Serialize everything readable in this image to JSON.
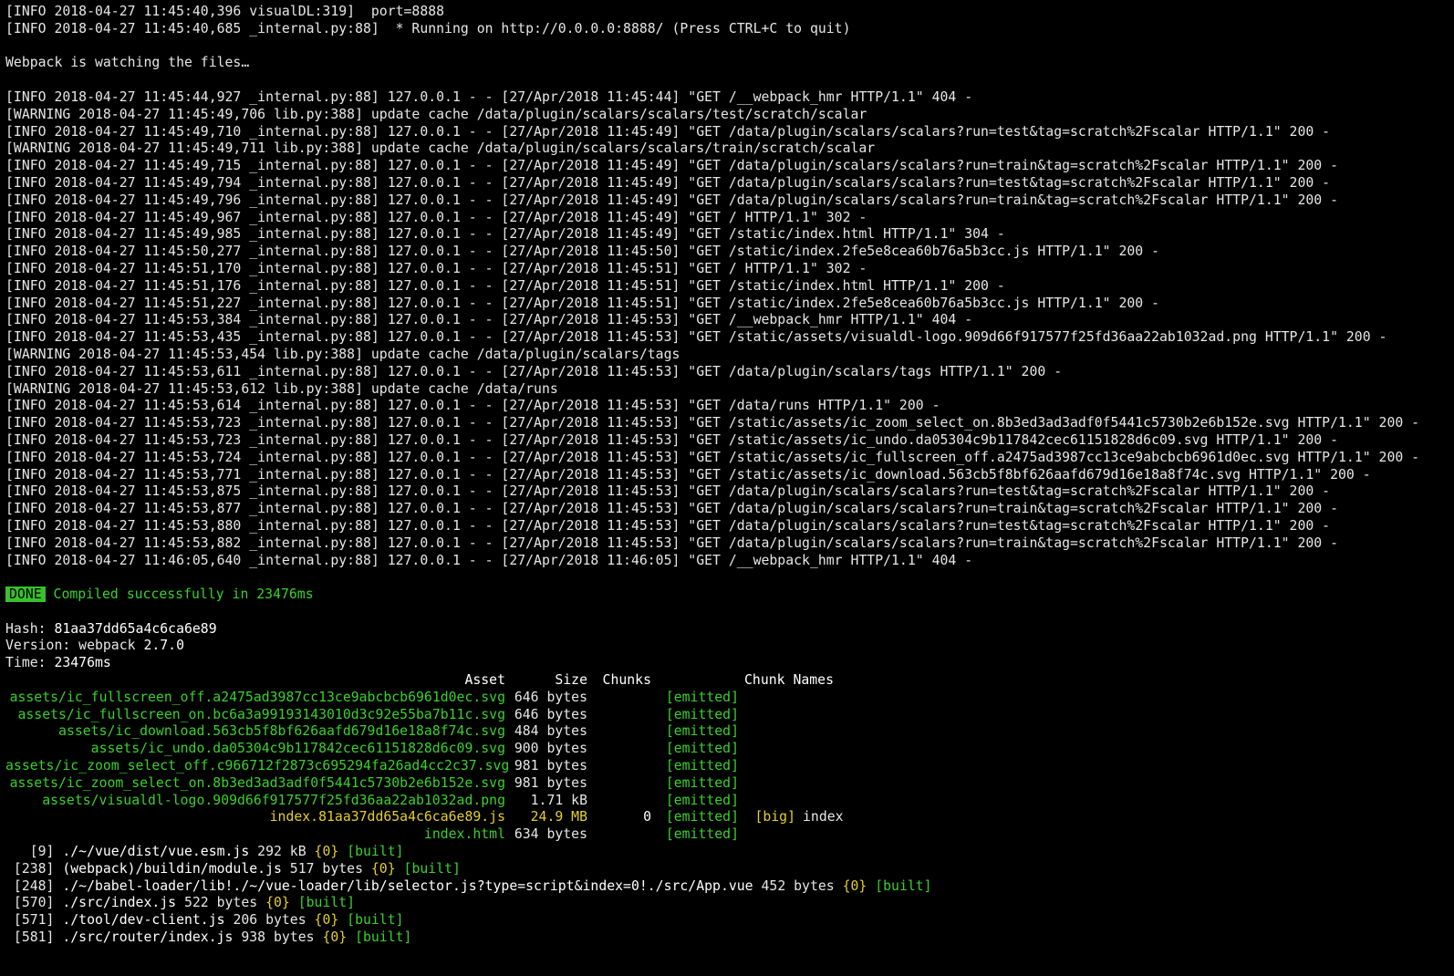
{
  "log_lines": [
    "[INFO 2018-04-27 11:45:40,396 visualDL:319]  port=8888",
    "[INFO 2018-04-27 11:45:40,685 _internal.py:88]  * Running on http://0.0.0.0:8888/ (Press CTRL+C to quit)",
    "",
    "Webpack is watching the files…",
    "",
    "[INFO 2018-04-27 11:45:44,927 _internal.py:88] 127.0.0.1 - - [27/Apr/2018 11:45:44] \"GET /__webpack_hmr HTTP/1.1\" 404 -",
    "[WARNING 2018-04-27 11:45:49,706 lib.py:388] update cache /data/plugin/scalars/scalars/test/scratch/scalar",
    "[INFO 2018-04-27 11:45:49,710 _internal.py:88] 127.0.0.1 - - [27/Apr/2018 11:45:49] \"GET /data/plugin/scalars/scalars?run=test&tag=scratch%2Fscalar HTTP/1.1\" 200 -",
    "[WARNING 2018-04-27 11:45:49,711 lib.py:388] update cache /data/plugin/scalars/scalars/train/scratch/scalar",
    "[INFO 2018-04-27 11:45:49,715 _internal.py:88] 127.0.0.1 - - [27/Apr/2018 11:45:49] \"GET /data/plugin/scalars/scalars?run=train&tag=scratch%2Fscalar HTTP/1.1\" 200 -",
    "[INFO 2018-04-27 11:45:49,794 _internal.py:88] 127.0.0.1 - - [27/Apr/2018 11:45:49] \"GET /data/plugin/scalars/scalars?run=test&tag=scratch%2Fscalar HTTP/1.1\" 200 -",
    "[INFO 2018-04-27 11:45:49,796 _internal.py:88] 127.0.0.1 - - [27/Apr/2018 11:45:49] \"GET /data/plugin/scalars/scalars?run=train&tag=scratch%2Fscalar HTTP/1.1\" 200 -",
    "[INFO 2018-04-27 11:45:49,967 _internal.py:88] 127.0.0.1 - - [27/Apr/2018 11:45:49] \"GET / HTTP/1.1\" 302 -",
    "[INFO 2018-04-27 11:45:49,985 _internal.py:88] 127.0.0.1 - - [27/Apr/2018 11:45:49] \"GET /static/index.html HTTP/1.1\" 304 -",
    "[INFO 2018-04-27 11:45:50,277 _internal.py:88] 127.0.0.1 - - [27/Apr/2018 11:45:50] \"GET /static/index.2fe5e8cea60b76a5b3cc.js HTTP/1.1\" 200 -",
    "[INFO 2018-04-27 11:45:51,170 _internal.py:88] 127.0.0.1 - - [27/Apr/2018 11:45:51] \"GET / HTTP/1.1\" 302 -",
    "[INFO 2018-04-27 11:45:51,176 _internal.py:88] 127.0.0.1 - - [27/Apr/2018 11:45:51] \"GET /static/index.html HTTP/1.1\" 200 -",
    "[INFO 2018-04-27 11:45:51,227 _internal.py:88] 127.0.0.1 - - [27/Apr/2018 11:45:51] \"GET /static/index.2fe5e8cea60b76a5b3cc.js HTTP/1.1\" 200 -",
    "[INFO 2018-04-27 11:45:53,384 _internal.py:88] 127.0.0.1 - - [27/Apr/2018 11:45:53] \"GET /__webpack_hmr HTTP/1.1\" 404 -",
    "[INFO 2018-04-27 11:45:53,435 _internal.py:88] 127.0.0.1 - - [27/Apr/2018 11:45:53] \"GET /static/assets/visualdl-logo.909d66f917577f25fd36aa22ab1032ad.png HTTP/1.1\" 200 -",
    "[WARNING 2018-04-27 11:45:53,454 lib.py:388] update cache /data/plugin/scalars/tags",
    "[INFO 2018-04-27 11:45:53,611 _internal.py:88] 127.0.0.1 - - [27/Apr/2018 11:45:53] \"GET /data/plugin/scalars/tags HTTP/1.1\" 200 -",
    "[WARNING 2018-04-27 11:45:53,612 lib.py:388] update cache /data/runs",
    "[INFO 2018-04-27 11:45:53,614 _internal.py:88] 127.0.0.1 - - [27/Apr/2018 11:45:53] \"GET /data/runs HTTP/1.1\" 200 -",
    "[INFO 2018-04-27 11:45:53,723 _internal.py:88] 127.0.0.1 - - [27/Apr/2018 11:45:53] \"GET /static/assets/ic_zoom_select_on.8b3ed3ad3adf0f5441c5730b2e6b152e.svg HTTP/1.1\" 200 -",
    "[INFO 2018-04-27 11:45:53,723 _internal.py:88] 127.0.0.1 - - [27/Apr/2018 11:45:53] \"GET /static/assets/ic_undo.da05304c9b117842cec61151828d6c09.svg HTTP/1.1\" 200 -",
    "[INFO 2018-04-27 11:45:53,724 _internal.py:88] 127.0.0.1 - - [27/Apr/2018 11:45:53] \"GET /static/assets/ic_fullscreen_off.a2475ad3987cc13ce9abcbcb6961d0ec.svg HTTP/1.1\" 200 -",
    "[INFO 2018-04-27 11:45:53,771 _internal.py:88] 127.0.0.1 - - [27/Apr/2018 11:45:53] \"GET /static/assets/ic_download.563cb5f8bf626aafd679d16e18a8f74c.svg HTTP/1.1\" 200 -",
    "[INFO 2018-04-27 11:45:53,875 _internal.py:88] 127.0.0.1 - - [27/Apr/2018 11:45:53] \"GET /data/plugin/scalars/scalars?run=test&tag=scratch%2Fscalar HTTP/1.1\" 200 -",
    "[INFO 2018-04-27 11:45:53,877 _internal.py:88] 127.0.0.1 - - [27/Apr/2018 11:45:53] \"GET /data/plugin/scalars/scalars?run=train&tag=scratch%2Fscalar HTTP/1.1\" 200 -",
    "[INFO 2018-04-27 11:45:53,880 _internal.py:88] 127.0.0.1 - - [27/Apr/2018 11:45:53] \"GET /data/plugin/scalars/scalars?run=test&tag=scratch%2Fscalar HTTP/1.1\" 200 -",
    "[INFO 2018-04-27 11:45:53,882 _internal.py:88] 127.0.0.1 - - [27/Apr/2018 11:45:53] \"GET /data/plugin/scalars/scalars?run=train&tag=scratch%2Fscalar HTTP/1.1\" 200 -",
    "[INFO 2018-04-27 11:46:05,640 _internal.py:88] 127.0.0.1 - - [27/Apr/2018 11:46:05] \"GET /__webpack_hmr HTTP/1.1\" 404 -"
  ],
  "build": {
    "done_badge": "DONE",
    "compiled_message": " Compiled successfully in 23476ms",
    "hash_label": "Hash: ",
    "hash_value": "81aa37dd65a4c6ca6e89",
    "version_label": "Version: webpack ",
    "version_value": "2.7.0",
    "time_label": "Time: ",
    "time_value": "23476ms"
  },
  "assets_table": {
    "headers": {
      "asset": "Asset",
      "size": "Size",
      "chunks": "Chunks",
      "chunk_names": "Chunk Names"
    },
    "rows": [
      {
        "name": "assets/ic_fullscreen_off.a2475ad3987cc13ce9abcbcb6961d0ec.svg",
        "size": "646 bytes",
        "chunks": "",
        "emitted": "[emitted]",
        "big": "",
        "chunk_name": "",
        "color": "green"
      },
      {
        "name": "assets/ic_fullscreen_on.bc6a3a99193143010d3c92e55ba7b11c.svg",
        "size": "646 bytes",
        "chunks": "",
        "emitted": "[emitted]",
        "big": "",
        "chunk_name": "",
        "color": "green"
      },
      {
        "name": "assets/ic_download.563cb5f8bf626aafd679d16e18a8f74c.svg",
        "size": "484 bytes",
        "chunks": "",
        "emitted": "[emitted]",
        "big": "",
        "chunk_name": "",
        "color": "green"
      },
      {
        "name": "assets/ic_undo.da05304c9b117842cec61151828d6c09.svg",
        "size": "900 bytes",
        "chunks": "",
        "emitted": "[emitted]",
        "big": "",
        "chunk_name": "",
        "color": "green"
      },
      {
        "name": "assets/ic_zoom_select_off.c966712f2873c695294fa26ad4cc2c37.svg",
        "size": "981 bytes",
        "chunks": "",
        "emitted": "[emitted]",
        "big": "",
        "chunk_name": "",
        "color": "green"
      },
      {
        "name": "assets/ic_zoom_select_on.8b3ed3ad3adf0f5441c5730b2e6b152e.svg",
        "size": "981 bytes",
        "chunks": "",
        "emitted": "[emitted]",
        "big": "",
        "chunk_name": "",
        "color": "green"
      },
      {
        "name": "assets/visualdl-logo.909d66f917577f25fd36aa22ab1032ad.png",
        "size": "1.71 kB",
        "chunks": "",
        "emitted": "[emitted]",
        "big": "",
        "chunk_name": "",
        "color": "green"
      },
      {
        "name": "index.81aa37dd65a4c6ca6e89.js",
        "size": "24.9 MB",
        "chunks": "0",
        "emitted": "[emitted]",
        "big": "[big]",
        "chunk_name": "index",
        "color": "yellow"
      },
      {
        "name": "index.html",
        "size": "634 bytes",
        "chunks": "",
        "emitted": "[emitted]",
        "big": "",
        "chunk_name": "",
        "color": "green"
      }
    ]
  },
  "modules": [
    {
      "id": "   [9] ",
      "path": "./~/vue/dist/vue.esm.js",
      "size": " 292 kB ",
      "chunk": "{0}",
      "status": " [built]"
    },
    {
      "id": " [238] ",
      "path": "(webpack)/buildin/module.js",
      "size": " 517 bytes ",
      "chunk": "{0}",
      "status": " [built]"
    },
    {
      "id": " [248] ",
      "path": "./~/babel-loader/lib!./~/vue-loader/lib/selector.js?type=script&index=0!./src/App.vue",
      "size": " 452 bytes ",
      "chunk": "{0}",
      "status": " [built]"
    },
    {
      "id": " [570] ",
      "path": "./src/index.js",
      "size": " 522 bytes ",
      "chunk": "{0}",
      "status": " [built]"
    },
    {
      "id": " [571] ",
      "path": "./tool/dev-client.js",
      "size": " 206 bytes ",
      "chunk": "{0}",
      "status": " [built]"
    },
    {
      "id": " [581] ",
      "path": "./src/router/index.js",
      "size": " 938 bytes ",
      "chunk": "{0}",
      "status": " [built]"
    }
  ],
  "colors": {
    "background": "#000000",
    "text": "#e6e6e6",
    "success_green": "#39d12b",
    "warning_yellow": "#e4cf2b",
    "done_badge_bg": "#39c12b"
  }
}
